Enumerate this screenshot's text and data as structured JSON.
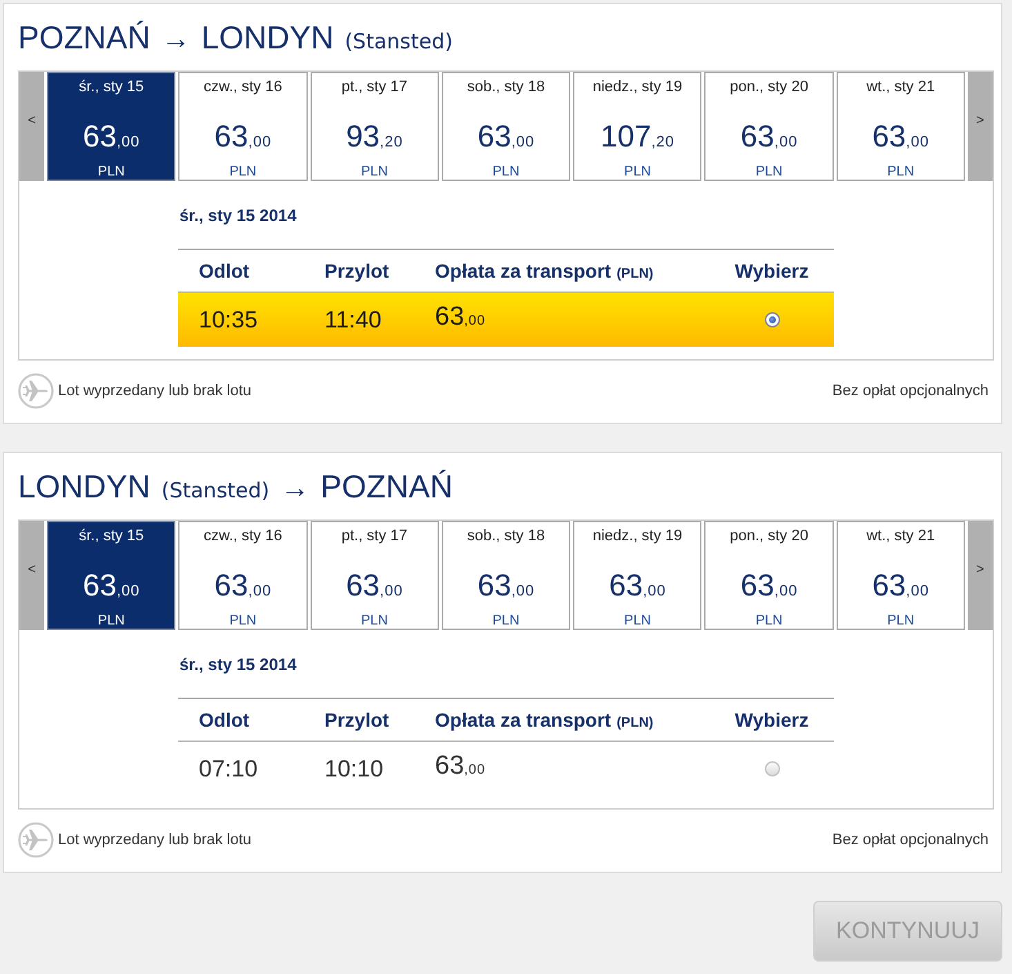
{
  "flights": [
    {
      "title": [
        {
          "kind": "city",
          "text": "POZNAŃ"
        },
        {
          "kind": "arrow",
          "text": "→"
        },
        {
          "kind": "city",
          "text": "LONDYN"
        },
        {
          "kind": "airport",
          "text": "(Stansted)"
        }
      ],
      "prev_button": "<",
      "next_button": ">",
      "dates": [
        {
          "day": "śr., sty 15",
          "price": "63",
          "decimals": ",00",
          "currency": "PLN",
          "selected": true
        },
        {
          "day": "czw., sty 16",
          "price": "63",
          "decimals": ",00",
          "currency": "PLN",
          "selected": false
        },
        {
          "day": "pt., sty 17",
          "price": "93",
          "decimals": ",20",
          "currency": "PLN",
          "selected": false
        },
        {
          "day": "sob., sty 18",
          "price": "63",
          "decimals": ",00",
          "currency": "PLN",
          "selected": false
        },
        {
          "day": "niedz., sty 19",
          "price": "107",
          "decimals": ",20",
          "currency": "PLN",
          "selected": false
        },
        {
          "day": "pon., sty 20",
          "price": "63",
          "decimals": ",00",
          "currency": "PLN",
          "selected": false
        },
        {
          "day": "wt., sty 21",
          "price": "63",
          "decimals": ",00",
          "currency": "PLN",
          "selected": false
        }
      ],
      "date_heading": "śr., sty 15 2014",
      "columns": [
        {
          "label": "Odlot"
        },
        {
          "label": "Przylot"
        },
        {
          "label": "Opłata za transport",
          "note": "(PLN)"
        },
        {
          "label": "Wybierz"
        }
      ],
      "rows": [
        {
          "departure": "10:35",
          "arrival": "11:40",
          "fare": "63",
          "decimals": ",00",
          "selected": true
        }
      ],
      "legend": "Lot wyprzedany lub brak lotu",
      "fees_note": "Bez opłat opcjonalnych"
    },
    {
      "title": [
        {
          "kind": "city",
          "text": "LONDYN"
        },
        {
          "kind": "airport",
          "text": "(Stansted)"
        },
        {
          "kind": "arrow",
          "text": "→"
        },
        {
          "kind": "city",
          "text": "POZNAŃ"
        }
      ],
      "prev_button": "<",
      "next_button": ">",
      "dates": [
        {
          "day": "śr., sty 15",
          "price": "63",
          "decimals": ",00",
          "currency": "PLN",
          "selected": true
        },
        {
          "day": "czw., sty 16",
          "price": "63",
          "decimals": ",00",
          "currency": "PLN",
          "selected": false
        },
        {
          "day": "pt., sty 17",
          "price": "63",
          "decimals": ",00",
          "currency": "PLN",
          "selected": false
        },
        {
          "day": "sob., sty 18",
          "price": "63",
          "decimals": ",00",
          "currency": "PLN",
          "selected": false
        },
        {
          "day": "niedz., sty 19",
          "price": "63",
          "decimals": ",00",
          "currency": "PLN",
          "selected": false
        },
        {
          "day": "pon., sty 20",
          "price": "63",
          "decimals": ",00",
          "currency": "PLN",
          "selected": false
        },
        {
          "day": "wt., sty 21",
          "price": "63",
          "decimals": ",00",
          "currency": "PLN",
          "selected": false
        }
      ],
      "date_heading": "śr., sty 15 2014",
      "columns": [
        {
          "label": "Odlot"
        },
        {
          "label": "Przylot"
        },
        {
          "label": "Opłata za transport",
          "note": "(PLN)"
        },
        {
          "label": "Wybierz"
        }
      ],
      "rows": [
        {
          "departure": "07:10",
          "arrival": "10:10",
          "fare": "63",
          "decimals": ",00",
          "selected": false
        }
      ],
      "legend": "Lot wyprzedany lub brak lotu",
      "fees_note": "Bez opłat opcjonalnych"
    }
  ],
  "continue_button": {
    "label": "KONTYNUUJ",
    "disabled": true
  }
}
